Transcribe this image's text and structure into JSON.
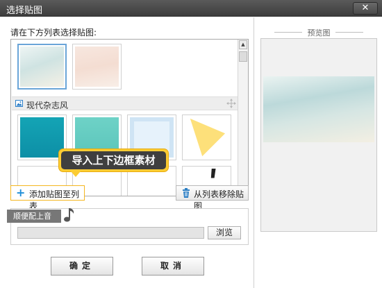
{
  "window": {
    "title": "选择贴图",
    "close_label": "✕"
  },
  "list_prompt": "请在下方列表选择贴图:",
  "thumbnails_row1": [
    {
      "style": "sky",
      "selected": true
    },
    {
      "style": "pink",
      "selected": false
    }
  ],
  "group": {
    "label": "现代杂志风",
    "icon": "image-icon"
  },
  "thumbnails_row2": [
    {
      "style": "teal-gradient"
    },
    {
      "style": "teal-light"
    },
    {
      "style": "blue-frame"
    },
    {
      "style": "yellow-triangle"
    }
  ],
  "tooltip": {
    "text": "导入上下边框素材",
    "accent": "#fbcc33"
  },
  "buttons": {
    "add_label": "添加贴图至列表",
    "remove_label": "从列表移除贴图",
    "browse_label": "浏览",
    "ok_label": "确定",
    "cancel_label": "取消"
  },
  "music": {
    "label": "顺便配上音效:",
    "path_value": ""
  },
  "preview": {
    "title": "预览图"
  },
  "colors": {
    "title_bar": "#4a4a4a",
    "accent_blue": "#1f8ed8",
    "tooltip_yellow": "#fbcc33"
  }
}
